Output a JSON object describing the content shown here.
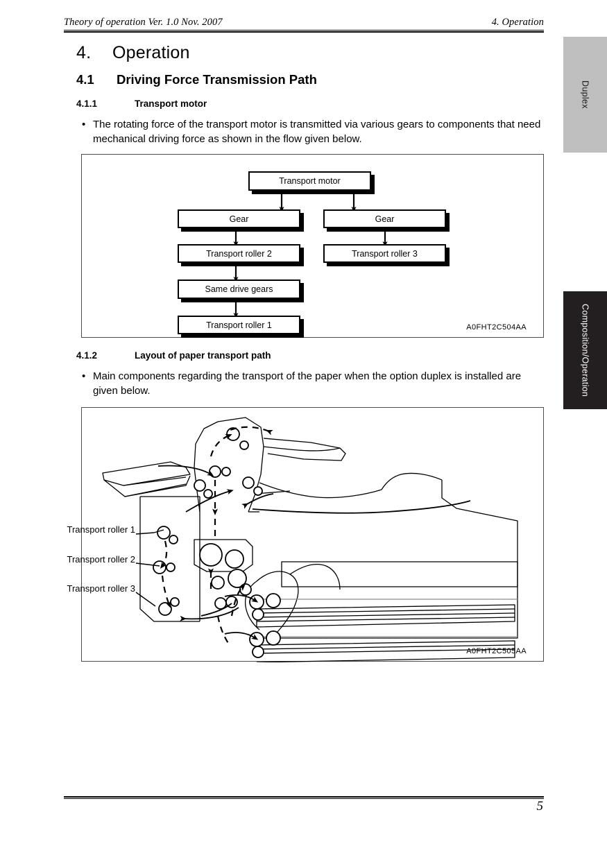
{
  "header": {
    "left": "Theory of operation Ver. 1.0 Nov. 2007",
    "right": "4. Operation"
  },
  "chapter": {
    "number": "4.",
    "title": "Operation"
  },
  "sections": {
    "s41": {
      "number": "4.1",
      "title": "Driving Force Transmission Path"
    },
    "s411": {
      "number": "4.1.1",
      "title": "Transport motor",
      "bullet_marker": "•",
      "bullet_text": "The rotating force of the transport motor is transmitted via various gears to components that need mechanical driving force as shown in the flow given below."
    },
    "s412": {
      "number": "4.1.2",
      "title": "Layout of paper transport path",
      "bullet_marker": "•",
      "bullet_text": "Main components regarding the transport of the paper when the option duplex is installed are given below."
    }
  },
  "figure1": {
    "id": "A0FHT2C504AA",
    "boxes": {
      "motor": "Transport motor",
      "gear_left": "Gear",
      "gear_right": "Gear",
      "roller2": "Transport roller 2",
      "roller3": "Transport roller 3",
      "same_drive_gears": "Same drive gears",
      "roller1": "Transport roller 1"
    }
  },
  "figure2": {
    "id": "A0FHT2C505AA",
    "labels": {
      "roller1": "Transport roller 1",
      "roller2": "Transport roller 2",
      "roller3": "Transport roller 3"
    }
  },
  "tabs": {
    "duplex": "Duplex",
    "section": "Composition/Operation"
  },
  "footer": {
    "page_number": "5"
  },
  "colors": {
    "tab_duplex_bg": "#bfbfbf",
    "tab_section_bg": "#231f20",
    "rule": "#000000",
    "figure_border": "#4d4d4d"
  }
}
